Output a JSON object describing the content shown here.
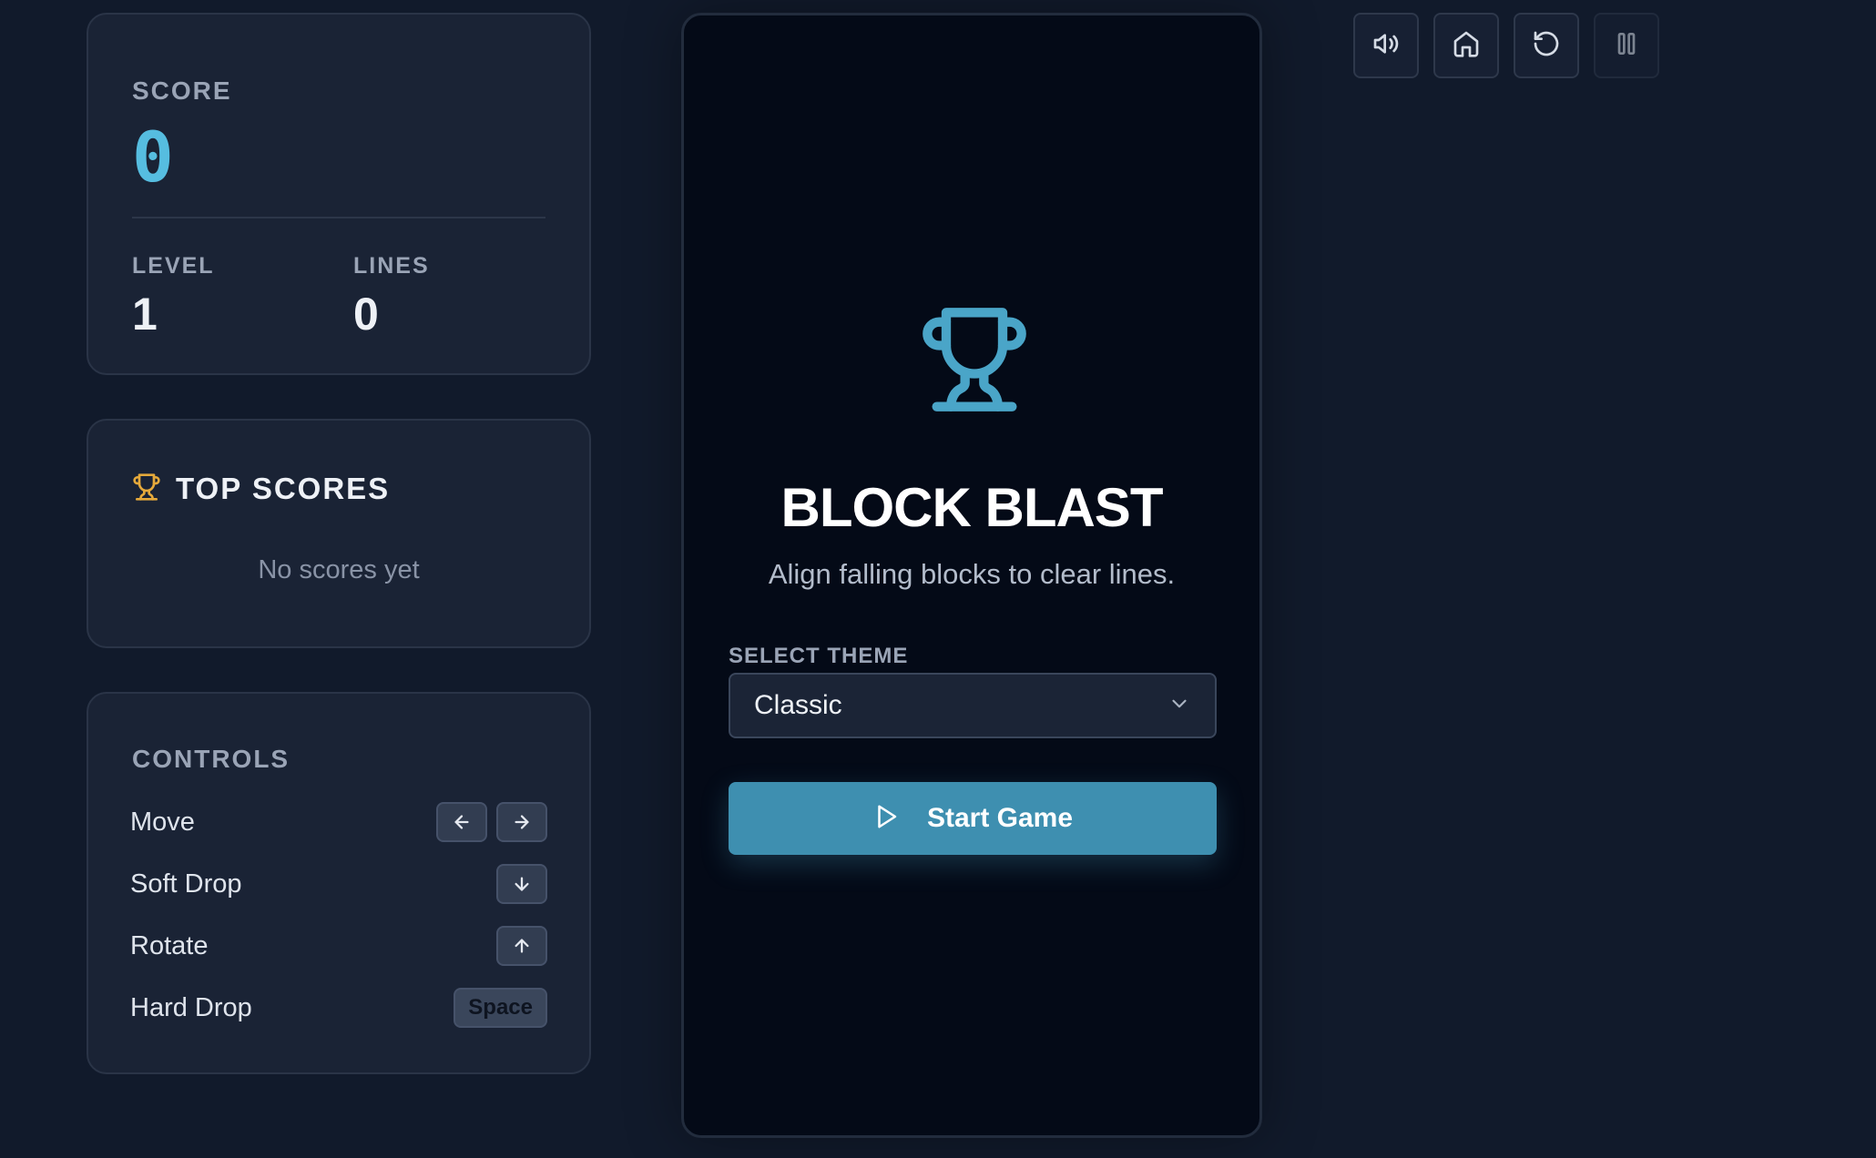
{
  "stats": {
    "score_label": "SCORE",
    "score": "0",
    "level_label": "LEVEL",
    "level": "1",
    "lines_label": "LINES",
    "lines": "0"
  },
  "top_scores": {
    "title": "TOP SCORES",
    "icon": "trophy-icon",
    "empty_text": "No scores yet"
  },
  "controls": {
    "title": "CONTROLS",
    "items": [
      {
        "name": "Move",
        "keys": [
          "arrow-left-icon",
          "arrow-right-icon"
        ]
      },
      {
        "name": "Soft Drop",
        "keys": [
          "arrow-down-icon"
        ]
      },
      {
        "name": "Rotate",
        "keys": [
          "arrow-up-icon"
        ]
      },
      {
        "name": "Hard Drop",
        "keys": [
          "Space"
        ]
      }
    ]
  },
  "game": {
    "icon": "trophy-icon",
    "title": "BLOCK BLAST",
    "subtitle": "Align falling blocks to clear lines.",
    "theme_label": "SELECT THEME",
    "theme_selected": "Classic",
    "start_label": "Start Game"
  },
  "toolbar": {
    "icons": [
      "volume-icon",
      "home-icon",
      "restart-icon",
      "pause-icon"
    ]
  },
  "colors": {
    "background": "#111a2b",
    "panel": "#1a2335",
    "board": "#040a17",
    "accent": "#3e8fb0",
    "score": "#56bde0",
    "trophy_small": "#e5a93b",
    "trophy_big": "#4aa5c8"
  }
}
